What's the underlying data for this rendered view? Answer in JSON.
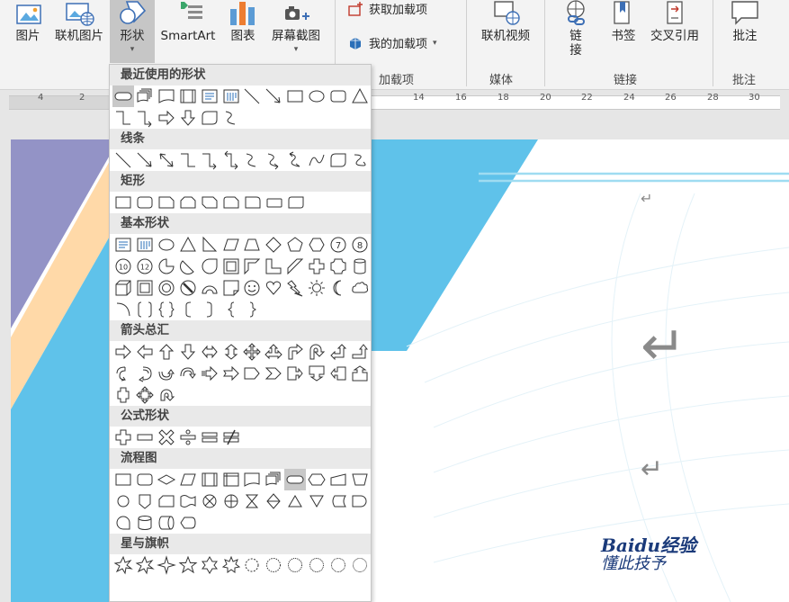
{
  "ribbon": {
    "buttons": {
      "picture": "图片",
      "online_picture": "联机图片",
      "shapes": "形状",
      "smartart": "SmartArt",
      "chart": "图表",
      "screenshot": "屏幕截图",
      "online_video": "联机视频",
      "link": "链接",
      "bookmark": "书签",
      "cross_reference": "交叉引用",
      "comment": "批注"
    },
    "addins": {
      "get_addins": "获取加载项",
      "my_addins": "我的加载项"
    },
    "groups": {
      "addins": "加载项",
      "media": "媒体",
      "links": "链接",
      "comments": "批注"
    }
  },
  "ruler": {
    "ticks": [
      "4",
      "2",
      "14",
      "16",
      "18",
      "20",
      "22",
      "24",
      "26",
      "28",
      "30"
    ]
  },
  "shapes_menu": {
    "categories": {
      "recent": "最近使用的形状",
      "lines": "线条",
      "rectangles": "矩形",
      "basic": "基本形状",
      "arrows": "箭头总汇",
      "equation": "公式形状",
      "flowchart": "流程图",
      "stars": "星与旗帜"
    },
    "selected_shape": "flowchart-terminator"
  },
  "watermark": {
    "text": "Baidu经验",
    "sub": "懂此技予"
  },
  "colors": {
    "ribbon_bg": "#f3f3f3",
    "active_button": "#c6c6c6",
    "highlight": "#e02020",
    "doc_blue": "#5fc2ea",
    "doc_purple": "#9393c6",
    "doc_peach": "#ffd9a8"
  }
}
